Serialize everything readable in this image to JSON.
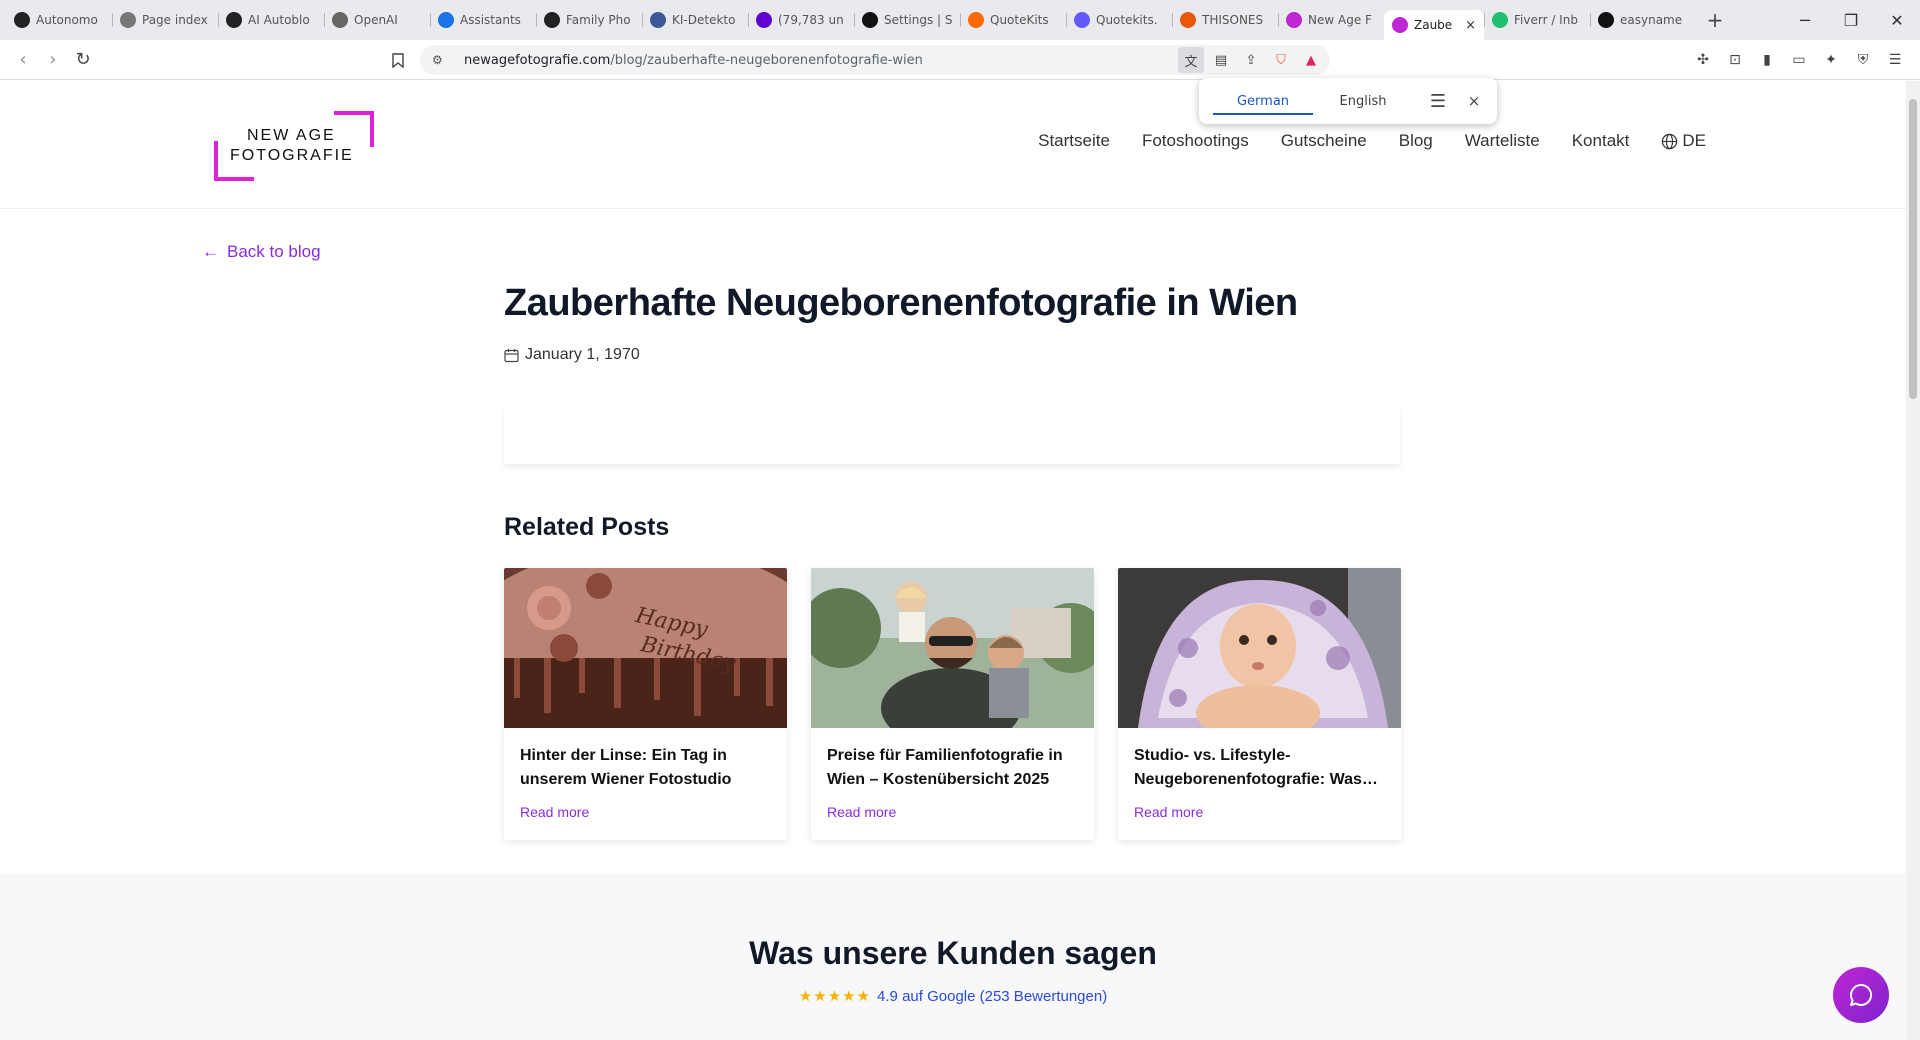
{
  "browser": {
    "tabs": [
      {
        "label": "Autonomo",
        "favicon": "openai-icon",
        "color": "#222222"
      },
      {
        "label": "Page index",
        "favicon": "page-index-icon",
        "color": "#777777"
      },
      {
        "label": "AI Autoblo",
        "favicon": "openai-icon",
        "color": "#222222"
      },
      {
        "label": "OpenAI",
        "favicon": "openai-icon",
        "color": "#666666"
      },
      {
        "label": "Assistants",
        "favicon": "assistants-icon",
        "color": "#1a73e8"
      },
      {
        "label": "Family Pho",
        "favicon": "openai-icon",
        "color": "#222222"
      },
      {
        "label": "KI-Detekto",
        "favicon": "ki-icon",
        "color": "#3b5998"
      },
      {
        "label": "(79,783 un",
        "favicon": "mail-icon",
        "color": "#6001d2"
      },
      {
        "label": "Settings | S",
        "favicon": "settings-icon",
        "color": "#111111"
      },
      {
        "label": "QuoteKits",
        "favicon": "quotekits-icon",
        "color": "#ff6a00"
      },
      {
        "label": "Quotekits.",
        "favicon": "s-icon",
        "color": "#635bff"
      },
      {
        "label": "THISONES",
        "favicon": "thisones-icon",
        "color": "#e8590c"
      },
      {
        "label": "New Age F",
        "favicon": "newage-icon",
        "color": "#c026d3"
      },
      {
        "label": "Zaube",
        "favicon": "newage-icon",
        "color": "#c026d3",
        "active": true
      },
      {
        "label": "Fiverr / Inb",
        "favicon": "fiverr-icon",
        "color": "#1dbf73"
      },
      {
        "label": "easyname",
        "favicon": "easyname-icon",
        "color": "#111111"
      }
    ],
    "active_tab_close": "×",
    "new_tab": "+",
    "url_domain": "newagefotografie.com",
    "url_path": "/blog/zauberhafte-neugeborenenfotografie-wien"
  },
  "translate": {
    "selected": "German",
    "other": "English",
    "close": "×"
  },
  "site": {
    "logo_line1": "NEW AGE",
    "logo_line2": "FOTOGRAFIE",
    "accent": "#e020d8",
    "nav": [
      "Startseite",
      "Fotoshootings",
      "Gutscheine",
      "Blog",
      "Warteliste",
      "Kontakt"
    ],
    "lang": "DE"
  },
  "post": {
    "back_link": "Back to blog",
    "title": "Zauberhafte Neugeborenenfotografie in Wien",
    "date": "January 1, 1970"
  },
  "related": {
    "heading": "Related Posts",
    "cards": [
      {
        "title": "Hinter der Linse: Ein Tag in unserem Wiener Fotostudio",
        "read_more": "Read more",
        "image": "birthday-cake-image"
      },
      {
        "title": "Preise für Familienfotografie in Wien – Kostenübersicht 2025",
        "read_more": "Read more",
        "image": "family-photo-image"
      },
      {
        "title": "Studio- vs. Lifestyle-Neugeborenenfotografie: Was…",
        "read_more": "Read more",
        "image": "baby-blanket-image"
      }
    ]
  },
  "testimonials": {
    "heading": "Was unsere Kunden sagen",
    "stars": "★★★★★",
    "rating_text": "4.9 auf Google (253 Bewertungen)"
  }
}
